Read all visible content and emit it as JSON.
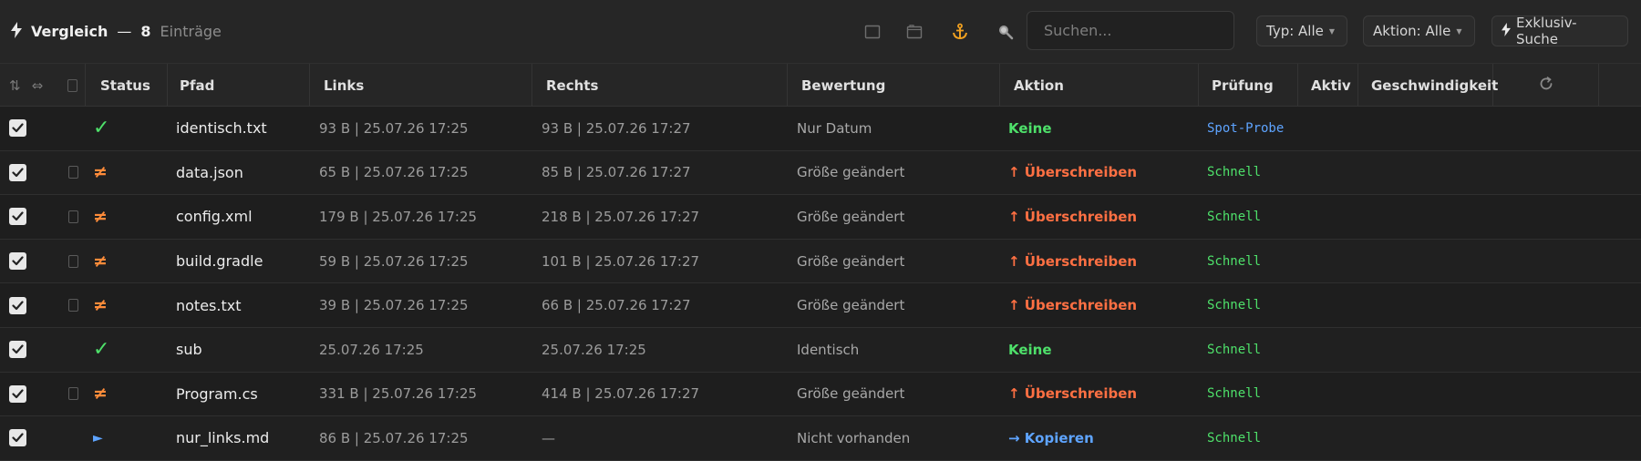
{
  "colors": {
    "accent_green": "#4ee06a",
    "accent_orange": "#ff7043",
    "accent_blue": "#5ea4ff",
    "anchor": "#f0a020"
  },
  "toolbar": {
    "title": "Vergleich",
    "dash": "—",
    "count": "8",
    "entries_label": "Einträge",
    "search_placeholder": "Suchen...",
    "type_filter": "Typ: Alle",
    "action_filter": "Aktion: Alle",
    "exclusive_search": "Exklusiv-Suche",
    "icons": [
      "bolt-icon",
      "window-icon",
      "folder-icon",
      "anchor-icon",
      "search-icon"
    ]
  },
  "columns": {
    "sort": "⇅",
    "swap": "⇔",
    "status": "Status",
    "path": "Pfad",
    "left": "Links",
    "right": "Rechts",
    "rating": "Bewertung",
    "action": "Aktion",
    "check": "Prüfung",
    "active": "Aktiv",
    "speed": "Geschwindigkeit"
  },
  "rows": [
    {
      "checked": true,
      "marker": false,
      "status": "same",
      "path": "identisch.txt",
      "left": "93 B | 25.07.26 17:25",
      "right": "93 B | 25.07.26 17:27",
      "rating": "Nur Datum",
      "action": "Keine",
      "action_kind": "none",
      "check": "Spot-Probe",
      "check_kind": "spot"
    },
    {
      "checked": true,
      "marker": true,
      "status": "diff",
      "path": "data.json",
      "left": "65 B | 25.07.26 17:25",
      "right": "85 B | 25.07.26 17:27",
      "rating": "Größe geändert",
      "action": "↑ Überschreiben",
      "action_kind": "over",
      "check": "Schnell",
      "check_kind": "fast"
    },
    {
      "checked": true,
      "marker": true,
      "status": "diff",
      "path": "config.xml",
      "left": "179 B | 25.07.26 17:25",
      "right": "218 B | 25.07.26 17:27",
      "rating": "Größe geändert",
      "action": "↑ Überschreiben",
      "action_kind": "over",
      "check": "Schnell",
      "check_kind": "fast"
    },
    {
      "checked": true,
      "marker": true,
      "status": "diff",
      "path": "build.gradle",
      "left": "59 B | 25.07.26 17:25",
      "right": "101 B | 25.07.26 17:27",
      "rating": "Größe geändert",
      "action": "↑ Überschreiben",
      "action_kind": "over",
      "check": "Schnell",
      "check_kind": "fast"
    },
    {
      "checked": true,
      "marker": true,
      "status": "diff",
      "path": "notes.txt",
      "left": "39 B | 25.07.26 17:25",
      "right": "66 B | 25.07.26 17:27",
      "rating": "Größe geändert",
      "action": "↑ Überschreiben",
      "action_kind": "over",
      "check": "Schnell",
      "check_kind": "fast"
    },
    {
      "checked": true,
      "marker": false,
      "status": "same",
      "path": "sub",
      "left": "25.07.26 17:25",
      "right": "25.07.26 17:25",
      "rating": "Identisch",
      "action": "Keine",
      "action_kind": "none",
      "check": "Schnell",
      "check_kind": "fast"
    },
    {
      "checked": true,
      "marker": true,
      "status": "diff",
      "path": "Program.cs",
      "left": "331 B | 25.07.26 17:25",
      "right": "414 B | 25.07.26 17:27",
      "rating": "Größe geändert",
      "action": "↑ Überschreiben",
      "action_kind": "over",
      "check": "Schnell",
      "check_kind": "fast"
    },
    {
      "checked": true,
      "marker": false,
      "status": "left",
      "path": "nur_links.md",
      "left": "86 B | 25.07.26 17:25",
      "right": "—",
      "rating": "Nicht vorhanden",
      "action": "→ Kopieren",
      "action_kind": "copy",
      "check": "Schnell",
      "check_kind": "fast"
    }
  ],
  "status_glyphs": {
    "same": "✓",
    "diff": "≠",
    "left": "►"
  }
}
